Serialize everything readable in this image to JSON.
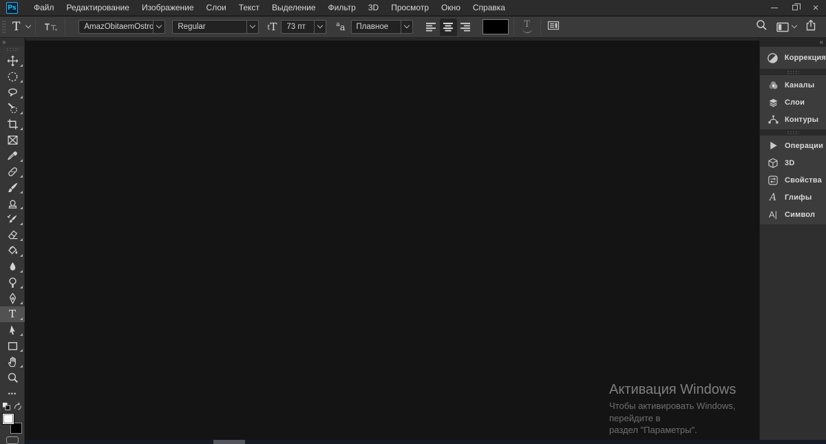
{
  "app": {
    "logo": "Ps"
  },
  "menubar": {
    "items": [
      "Файл",
      "Редактирование",
      "Изображение",
      "Слои",
      "Текст",
      "Выделение",
      "Фильтр",
      "3D",
      "Просмотр",
      "Окно",
      "Справка"
    ]
  },
  "icons": {
    "close": "×",
    "expand_toolbar": "»",
    "collapse_dock": "«",
    "type_tool": "T",
    "warp_text": "T",
    "size_small": "t",
    "size_big": "T",
    "aa_small": "a",
    "aa_big": "a",
    "ellipsis": "•••"
  },
  "options_bar": {
    "font_family": "AmazObitaemOstrovFine",
    "font_style": "Regular",
    "font_size": "73 пт",
    "anti_alias": "Плавное",
    "alignment_active": "center",
    "text_color": "#000000"
  },
  "toolbar": {
    "selected_tool": "type-tool",
    "foreground_color": "#ffffff",
    "background_color": "#000000"
  },
  "right_dock": {
    "groups": [
      [
        {
          "icon": "adjustments-icon",
          "label": "Коррекция"
        }
      ],
      [
        {
          "icon": "channels-icon",
          "label": "Каналы"
        },
        {
          "icon": "layers-icon",
          "label": "Слои"
        },
        {
          "icon": "paths-icon",
          "label": "Контуры"
        }
      ],
      [
        {
          "icon": "actions-icon",
          "label": "Операции"
        },
        {
          "icon": "cube-3d-icon",
          "label": "3D"
        },
        {
          "icon": "properties-icon",
          "label": "Свойства"
        },
        {
          "icon": "glyphs-icon",
          "label": "Глифы",
          "glyph": "A"
        },
        {
          "icon": "character-icon",
          "label": "Символ",
          "glyph": "A|"
        }
      ]
    ]
  },
  "watermark": {
    "title": "Активация Windows",
    "line1": "Чтобы активировать Windows, перейдите в",
    "line2": "раздел \"Параметры\"."
  }
}
